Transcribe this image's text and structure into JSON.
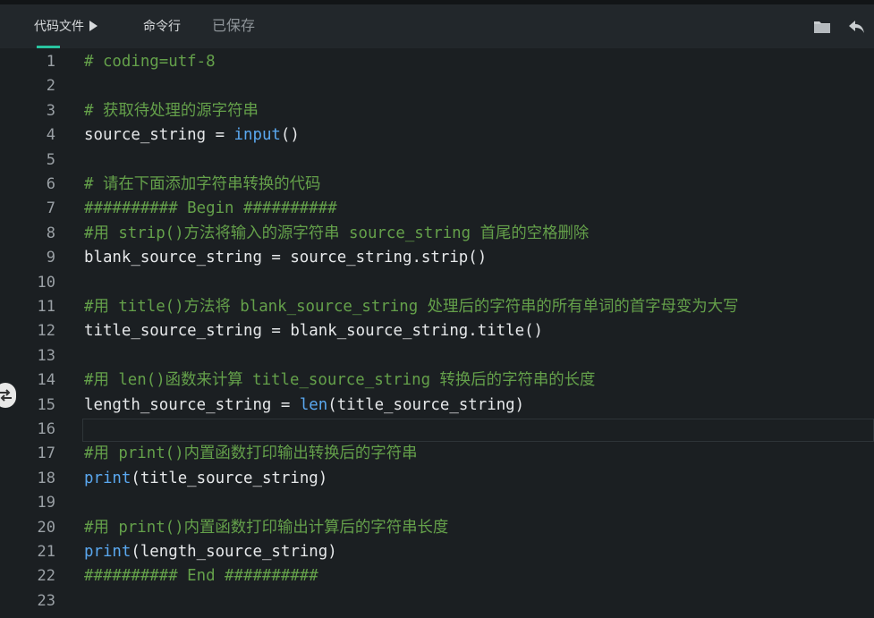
{
  "toolbar": {
    "file_tab": "代码文件",
    "cmd_tab": "命令行",
    "status": "已保存",
    "icons": [
      "folder-icon",
      "undo-icon",
      "caret-right-icon"
    ]
  },
  "editor": {
    "lines": [
      {
        "num": "1",
        "tokens": [
          {
            "t": "# coding=utf-8",
            "c": "comment"
          }
        ]
      },
      {
        "num": "2",
        "tokens": []
      },
      {
        "num": "3",
        "tokens": [
          {
            "t": "# 获取待处理的源字符串",
            "c": "comment"
          }
        ]
      },
      {
        "num": "4",
        "tokens": [
          {
            "t": "source_string = ",
            "c": "plain"
          },
          {
            "t": "input",
            "c": "builtin"
          },
          {
            "t": "()",
            "c": "plain"
          }
        ]
      },
      {
        "num": "5",
        "tokens": []
      },
      {
        "num": "6",
        "tokens": [
          {
            "t": "# 请在下面添加字符串转换的代码",
            "c": "comment"
          }
        ]
      },
      {
        "num": "7",
        "tokens": [
          {
            "t": "########## Begin ##########",
            "c": "comment"
          }
        ]
      },
      {
        "num": "8",
        "tokens": [
          {
            "t": "#用 strip()方法将输入的源字符串 source_string 首尾的空格删除",
            "c": "comment"
          }
        ]
      },
      {
        "num": "9",
        "tokens": [
          {
            "t": "blank_source_string = source_string.strip()",
            "c": "plain"
          }
        ]
      },
      {
        "num": "10",
        "tokens": []
      },
      {
        "num": "11",
        "tokens": [
          {
            "t": "#用 title()方法将 blank_source_string 处理后的字符串的所有单词的首字母变为大写",
            "c": "comment"
          }
        ]
      },
      {
        "num": "12",
        "tokens": [
          {
            "t": "title_source_string = blank_source_string.title()",
            "c": "plain"
          }
        ]
      },
      {
        "num": "13",
        "tokens": []
      },
      {
        "num": "14",
        "tokens": [
          {
            "t": "#用 len()函数来计算 title_source_string 转换后的字符串的长度",
            "c": "comment"
          }
        ]
      },
      {
        "num": "15",
        "tokens": [
          {
            "t": "length_source_string = ",
            "c": "plain"
          },
          {
            "t": "len",
            "c": "builtin"
          },
          {
            "t": "(title_source_string)",
            "c": "plain"
          }
        ]
      },
      {
        "num": "16",
        "tokens": []
      },
      {
        "num": "17",
        "tokens": [
          {
            "t": "#用 print()内置函数打印输出转换后的字符串",
            "c": "comment"
          }
        ]
      },
      {
        "num": "18",
        "tokens": [
          {
            "t": "print",
            "c": "builtin"
          },
          {
            "t": "(title_source_string)",
            "c": "plain"
          }
        ]
      },
      {
        "num": "19",
        "tokens": []
      },
      {
        "num": "20",
        "tokens": [
          {
            "t": "#用 print()内置函数打印输出计算后的字符串长度",
            "c": "comment"
          }
        ]
      },
      {
        "num": "21",
        "tokens": [
          {
            "t": "print",
            "c": "builtin"
          },
          {
            "t": "(length_source_string)",
            "c": "plain"
          }
        ]
      },
      {
        "num": "22",
        "tokens": [
          {
            "t": "########## End ##########",
            "c": "comment"
          }
        ]
      },
      {
        "num": "23",
        "tokens": []
      }
    ]
  },
  "colors": {
    "background": "#1b1f22",
    "comment": "#64a04a",
    "builtin": "#5aa8f0",
    "accent": "#29c4a0"
  }
}
